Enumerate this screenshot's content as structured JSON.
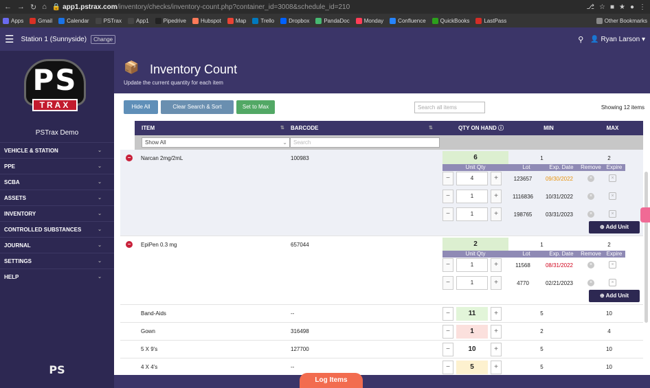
{
  "browser": {
    "url_host": "app1.pstrax.com",
    "url_path": "/inventory/checks/inventory-count.php?container_id=3008&schedule_id=210",
    "bookmarks": [
      {
        "label": "Apps",
        "color": "#6a6af0"
      },
      {
        "label": "Gmail",
        "color": "#d93025"
      },
      {
        "label": "Calendar",
        "color": "#1a73e8"
      },
      {
        "label": "PSTrax",
        "color": "#444444"
      },
      {
        "label": "App1",
        "color": "#444444"
      },
      {
        "label": "Pipedrive",
        "color": "#222222"
      },
      {
        "label": "Hubspot",
        "color": "#ff7a59"
      },
      {
        "label": "Map",
        "color": "#ea4335"
      },
      {
        "label": "Trello",
        "color": "#0079bf"
      },
      {
        "label": "Dropbox",
        "color": "#0061ff"
      },
      {
        "label": "PandaDoc",
        "color": "#47b972"
      },
      {
        "label": "Monday",
        "color": "#ff3d57"
      },
      {
        "label": "Confluence",
        "color": "#2684ff"
      },
      {
        "label": "QuickBooks",
        "color": "#2ca01c"
      },
      {
        "label": "LastPass",
        "color": "#d32d27"
      }
    ],
    "other_bookmarks": "Other Bookmarks"
  },
  "appbar": {
    "station": "Station 1 (Sunnyside)",
    "change_label": "Change",
    "user": "Ryan Larson"
  },
  "sidebar": {
    "logo_text": "PS",
    "logo_sub": "TRAX",
    "demo_name": "PSTrax Demo",
    "items": [
      {
        "label": "VEHICLE & STATION"
      },
      {
        "label": "PPE"
      },
      {
        "label": "SCBA"
      },
      {
        "label": "ASSETS"
      },
      {
        "label": "INVENTORY"
      },
      {
        "label": "CONTROLLED SUBSTANCES"
      },
      {
        "label": "JOURNAL"
      },
      {
        "label": "SETTINGS"
      },
      {
        "label": "HELP"
      }
    ],
    "footer_logo": "PS"
  },
  "header": {
    "title": "Inventory Count",
    "subtitle": "Update the current quantity for each item"
  },
  "toolbar": {
    "hide_all": "Hide All",
    "clear": "Clear Search & Sort",
    "set_max": "Set to Max",
    "search_placeholder": "Search all items",
    "showing": "Showing 12 items"
  },
  "table": {
    "columns": {
      "item": "ITEM",
      "barcode": "BARCODE",
      "qty": "QTY ON HAND",
      "min": "MIN",
      "max": "MAX"
    },
    "filter_show_all": "Show All",
    "filter_search": "Search",
    "sub_headers": {
      "unit_qty": "Unit Qty",
      "lot": "Lot",
      "exp": "Exp. Date",
      "remove": "Remove",
      "expire": "Expire"
    },
    "add_unit": "Add Unit",
    "rows": [
      {
        "name": "Narcan 2mg/2mL",
        "barcode": "100983",
        "qty": "6",
        "min": "1",
        "max": "2",
        "units": [
          {
            "qty": "4",
            "lot": "123657",
            "exp": "09/30/2022",
            "exp_color": "#e8930c"
          },
          {
            "qty": "1",
            "lot": "1116836",
            "exp": "10/31/2022",
            "exp_color": "#222222"
          },
          {
            "qty": "1",
            "lot": "198765",
            "exp": "03/31/2023",
            "exp_color": "#222222"
          }
        ]
      },
      {
        "name": "EpiPen 0.3 mg",
        "barcode": "657044",
        "qty": "2",
        "min": "1",
        "max": "2",
        "units": [
          {
            "qty": "1",
            "lot": "11568",
            "exp": "08/31/2022",
            "exp_color": "#d0021b"
          },
          {
            "qty": "1",
            "lot": "4770",
            "exp": "02/21/2023",
            "exp_color": "#222222"
          }
        ]
      },
      {
        "name": "Band-Aids",
        "barcode": "--",
        "qty": "11",
        "min": "5",
        "max": "10",
        "qty_bg": "#e2f5d9"
      },
      {
        "name": "Gown",
        "barcode": "316498",
        "qty": "1",
        "min": "2",
        "max": "4",
        "qty_bg": "#fbe0dd"
      },
      {
        "name": "5 X 9's",
        "barcode": "127700",
        "qty": "10",
        "min": "5",
        "max": "10",
        "qty_bg": "#ffffff"
      },
      {
        "name": "4 X 4's",
        "barcode": "--",
        "qty": "5",
        "min": "5",
        "max": "10",
        "qty_bg": "#fdf1cf"
      }
    ]
  },
  "footer": {
    "log_items": "Log Items"
  }
}
